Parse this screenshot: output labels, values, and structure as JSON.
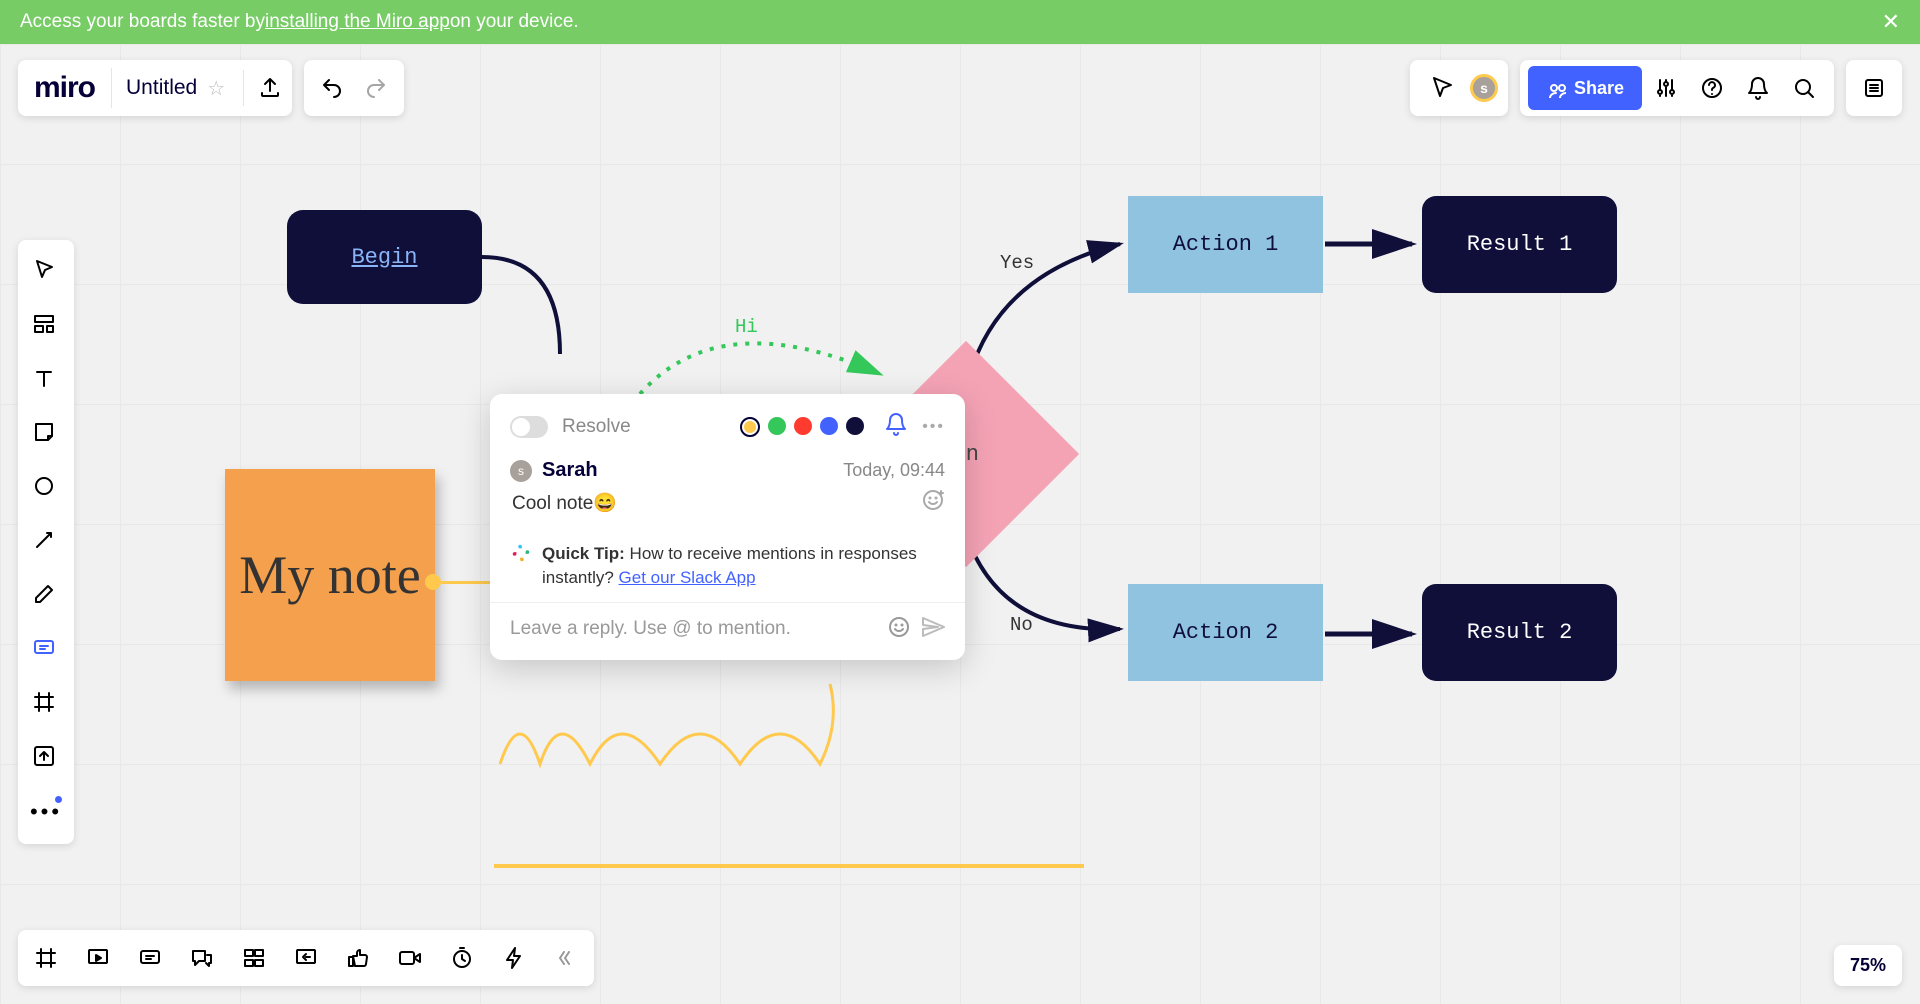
{
  "banner": {
    "text_prefix": "Access your boards faster by ",
    "link_text": "installing the Miro app",
    "text_suffix": " on your device."
  },
  "header": {
    "logo": "miro",
    "title": "Untitled",
    "share_label": "Share",
    "avatar_initial": "s"
  },
  "canvas_nodes": {
    "begin": "Begin",
    "decision_partial": "on",
    "action1": "Action 1",
    "action2": "Action 2",
    "result1": "Result 1",
    "result2": "Result 2",
    "sticky": "My note",
    "edge_yes": "Yes",
    "edge_no": "No",
    "edge_hi": "Hi"
  },
  "comment": {
    "resolve_label": "Resolve",
    "colors": [
      "#ffc94d",
      "#34c759",
      "#ff3b30",
      "#4262ff",
      "#0f0f3a"
    ],
    "selected_color_index": 0,
    "author_initial": "s",
    "author": "Sarah",
    "timestamp": "Today, 09:44",
    "message": "Cool note😄",
    "tip_bold": "Quick Tip:",
    "tip_rest": " How to receive mentions in responses instantly? ",
    "tip_link": "Get our Slack App",
    "reply_placeholder": "Leave a reply. Use @ to mention."
  },
  "zoom": "75%"
}
